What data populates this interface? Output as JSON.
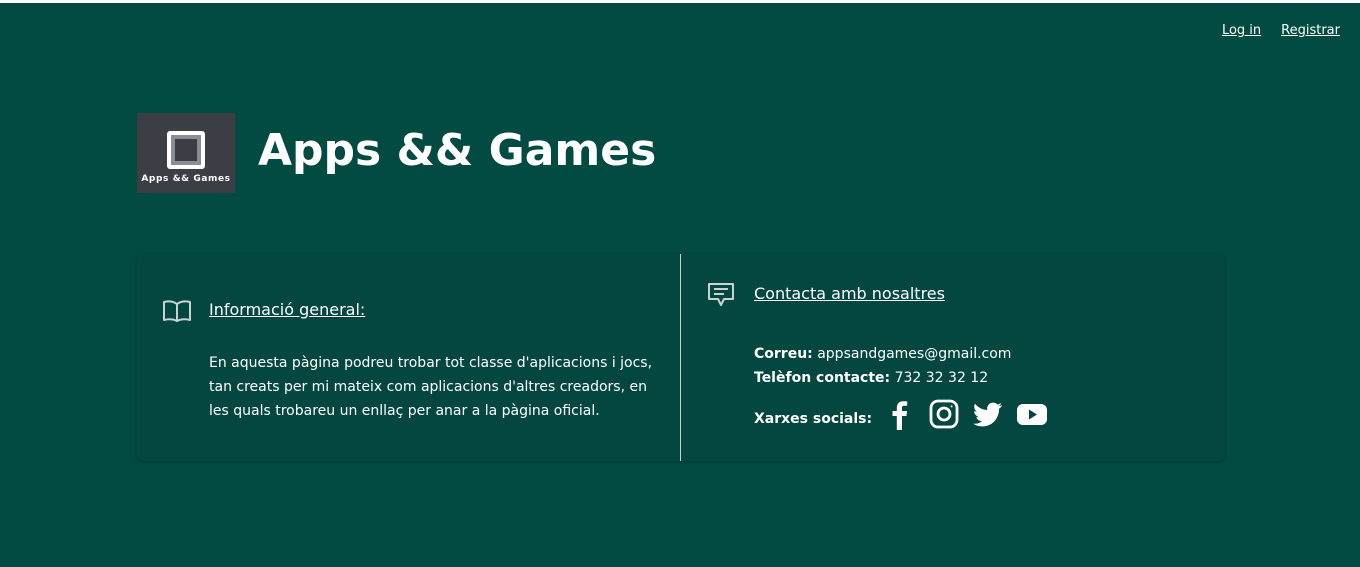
{
  "nav": {
    "login": "Log in",
    "register": "Registrar"
  },
  "brand": {
    "logo_text": "Apps && Games",
    "title": "Apps && Games"
  },
  "info": {
    "icon": "book-icon",
    "title": "Informació general:",
    "text": "En aquesta pàgina podreu trobar tot classe d'aplicacions i jocs, tan creats per mi mateix com aplicacions d'altres creadors, en les quals trobareu un enllaç per anar a la pàgina oficial."
  },
  "contact": {
    "icon": "message-icon",
    "title": "Contacta amb nosaltres",
    "email_label": "Correu:",
    "email_value": "appsandgames@gmail.com",
    "phone_label": "Telèfon contacte:",
    "phone_value": "732 32 32 12",
    "social_label": "Xarxes socials:",
    "social_icons": [
      "facebook-icon",
      "instagram-icon",
      "twitter-icon",
      "youtube-icon"
    ]
  },
  "colors": {
    "background": "#024b43",
    "card": "#044740",
    "logo_bg": "#3b3e45",
    "text": "#ffffff"
  }
}
